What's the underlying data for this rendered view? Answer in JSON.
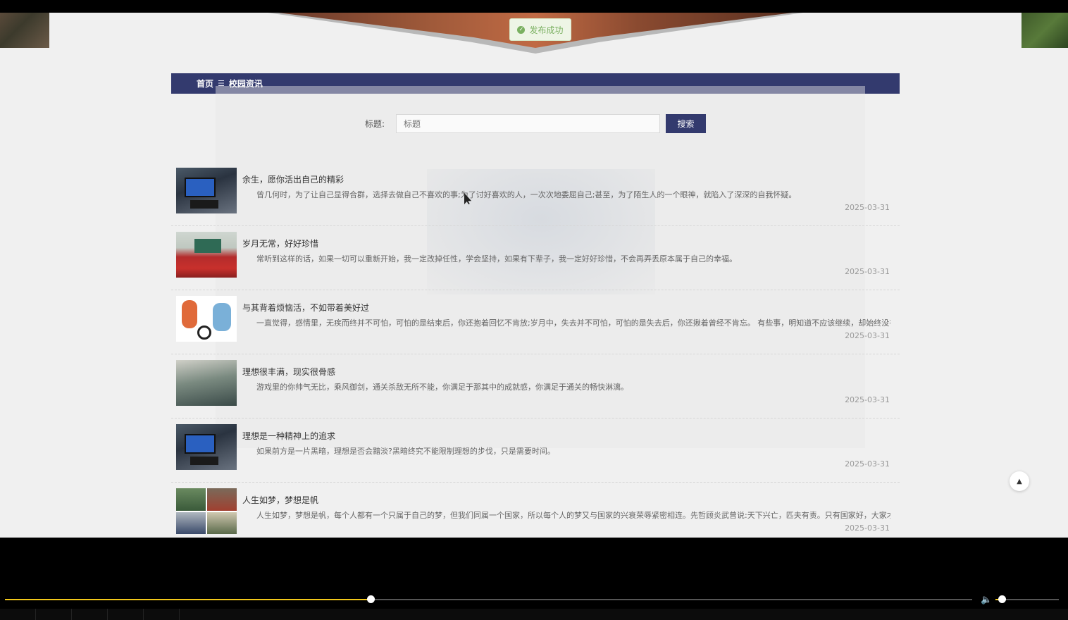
{
  "toast": {
    "text": "发布成功",
    "icon": "check-circle-icon"
  },
  "breadcrumb": {
    "home": "首页",
    "separator": "☰",
    "current": "校园资讯"
  },
  "search": {
    "label": "标题:",
    "placeholder": "标题",
    "button": "搜索"
  },
  "news": [
    {
      "title": "余生，愿你活出自己的精彩",
      "summary": "曾几何时，为了让自己显得合群，选择去做自己不喜欢的事;为了讨好喜欢的人，一次次地委屈自己;甚至，为了陌生人的一个眼神，就陷入了深深的自我怀疑。",
      "date": "2025-03-31",
      "thumb": "computer-class"
    },
    {
      "title": "岁月无常，好好珍惜",
      "summary": "常听到这样的话，如果一切可以重新开始，我一定改掉任性，学会坚持，如果有下辈子，我一定好好珍惜，不会再弄丢原本属于自己的幸福。",
      "date": "2025-03-31",
      "thumb": "classroom"
    },
    {
      "title": "与其背着烦恼活，不如带着美好过",
      "summary": "一直觉得，感情里，无疾而终并不可怕，可怕的是结束后，你还抱着回忆不肯放;岁月中，失去并不可怕，可怕的是失去后，你还揪着曾经不肯忘。 有些事，明知道不应该继续，却始终没有转身的勇气;有",
      "date": "2025-03-31",
      "thumb": "kids-cartoon"
    },
    {
      "title": "理想很丰满，现实很骨感",
      "summary": "游戏里的你帅气无比，乘风御剑，通关杀敌无所不能，你满足于那其中的成就感，你满足于通关的畅快淋漓。",
      "date": "2025-03-31",
      "thumb": "lab"
    },
    {
      "title": "理想是一种精神上的追求",
      "summary": "如果前方是一片黑暗，理想是否会黯淡?黑暗终究不能限制理想的步伐，只是需要时间。",
      "date": "2025-03-31",
      "thumb": "computer-class"
    },
    {
      "title": "人生如梦，梦想是帆",
      "summary": "人生如梦，梦想是帆，每个人都有一个只属于自己的梦，但我们同属一个国家，所以每个人的梦又与国家的兴衰荣辱紧密相连。先哲顾炎武曾说:天下兴亡，匹夫有责。只有国家好，大家才能好。",
      "date": "2025-03-31",
      "thumb": "collage"
    }
  ],
  "player": {
    "progress": 0.378,
    "volume": 0.1,
    "volume_icon": "speaker-icon"
  },
  "back_to_top": {
    "icon": "caret-up-icon",
    "glyph": "▲"
  },
  "colors": {
    "accent": "#333a6e",
    "progress": "#f2c81a",
    "toast": "#7ab060"
  }
}
